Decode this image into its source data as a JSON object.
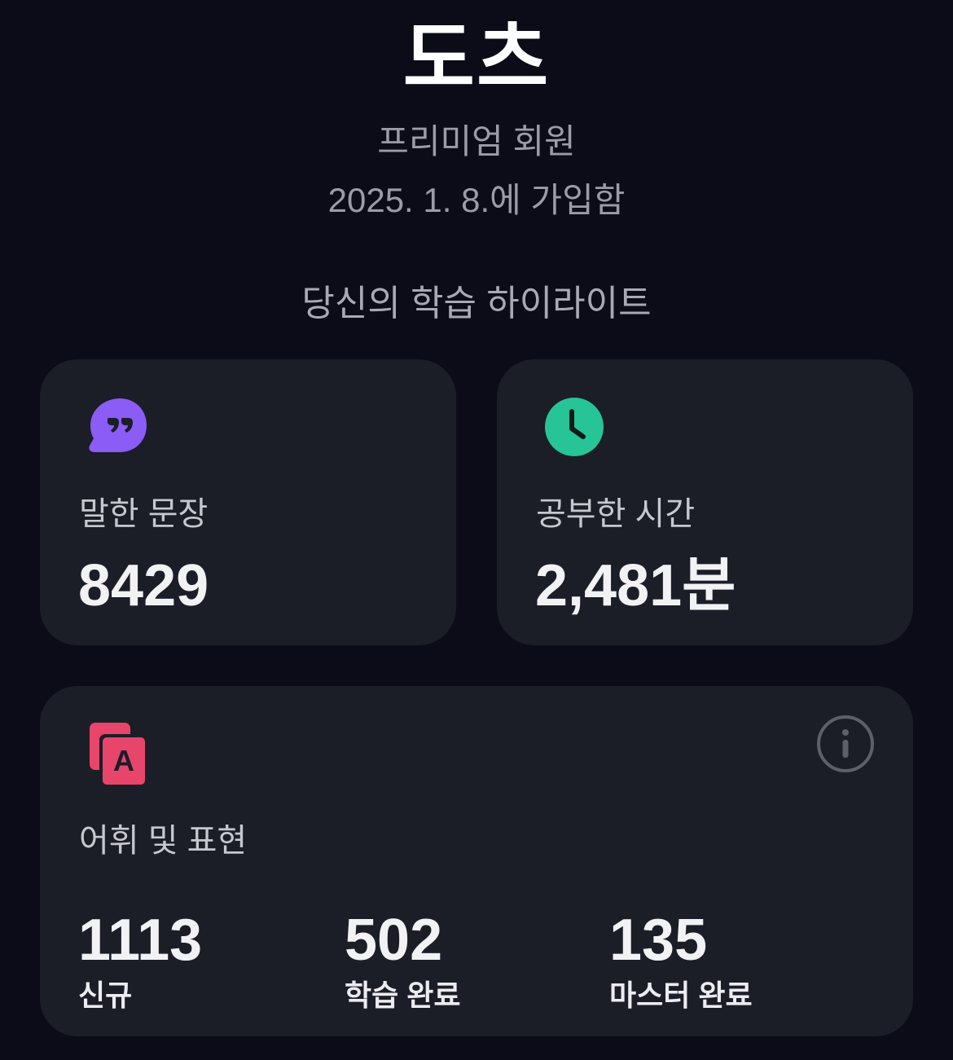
{
  "profile": {
    "name": "도츠",
    "membership": "프리미엄 회원",
    "joined": "2025. 1. 8.에 가입함"
  },
  "highlights": {
    "title": "당신의 학습 하이라이트",
    "sentences": {
      "label": "말한 문장",
      "value": "8429",
      "icon": "quote-bubble-icon",
      "color": "#8b5cf6"
    },
    "study_time": {
      "label": "공부한 시간",
      "value": "2,481분",
      "icon": "clock-icon",
      "color": "#26c496"
    },
    "vocabulary": {
      "label": "어휘 및 표현",
      "icon": "flashcards-icon",
      "color": "#e8456b",
      "icon_letter": "A",
      "info_icon": "info-icon",
      "stats": [
        {
          "value": "1113",
          "caption": "신규"
        },
        {
          "value": "502",
          "caption": "학습 완료"
        },
        {
          "value": "135",
          "caption": "마스터 완료"
        }
      ]
    }
  }
}
